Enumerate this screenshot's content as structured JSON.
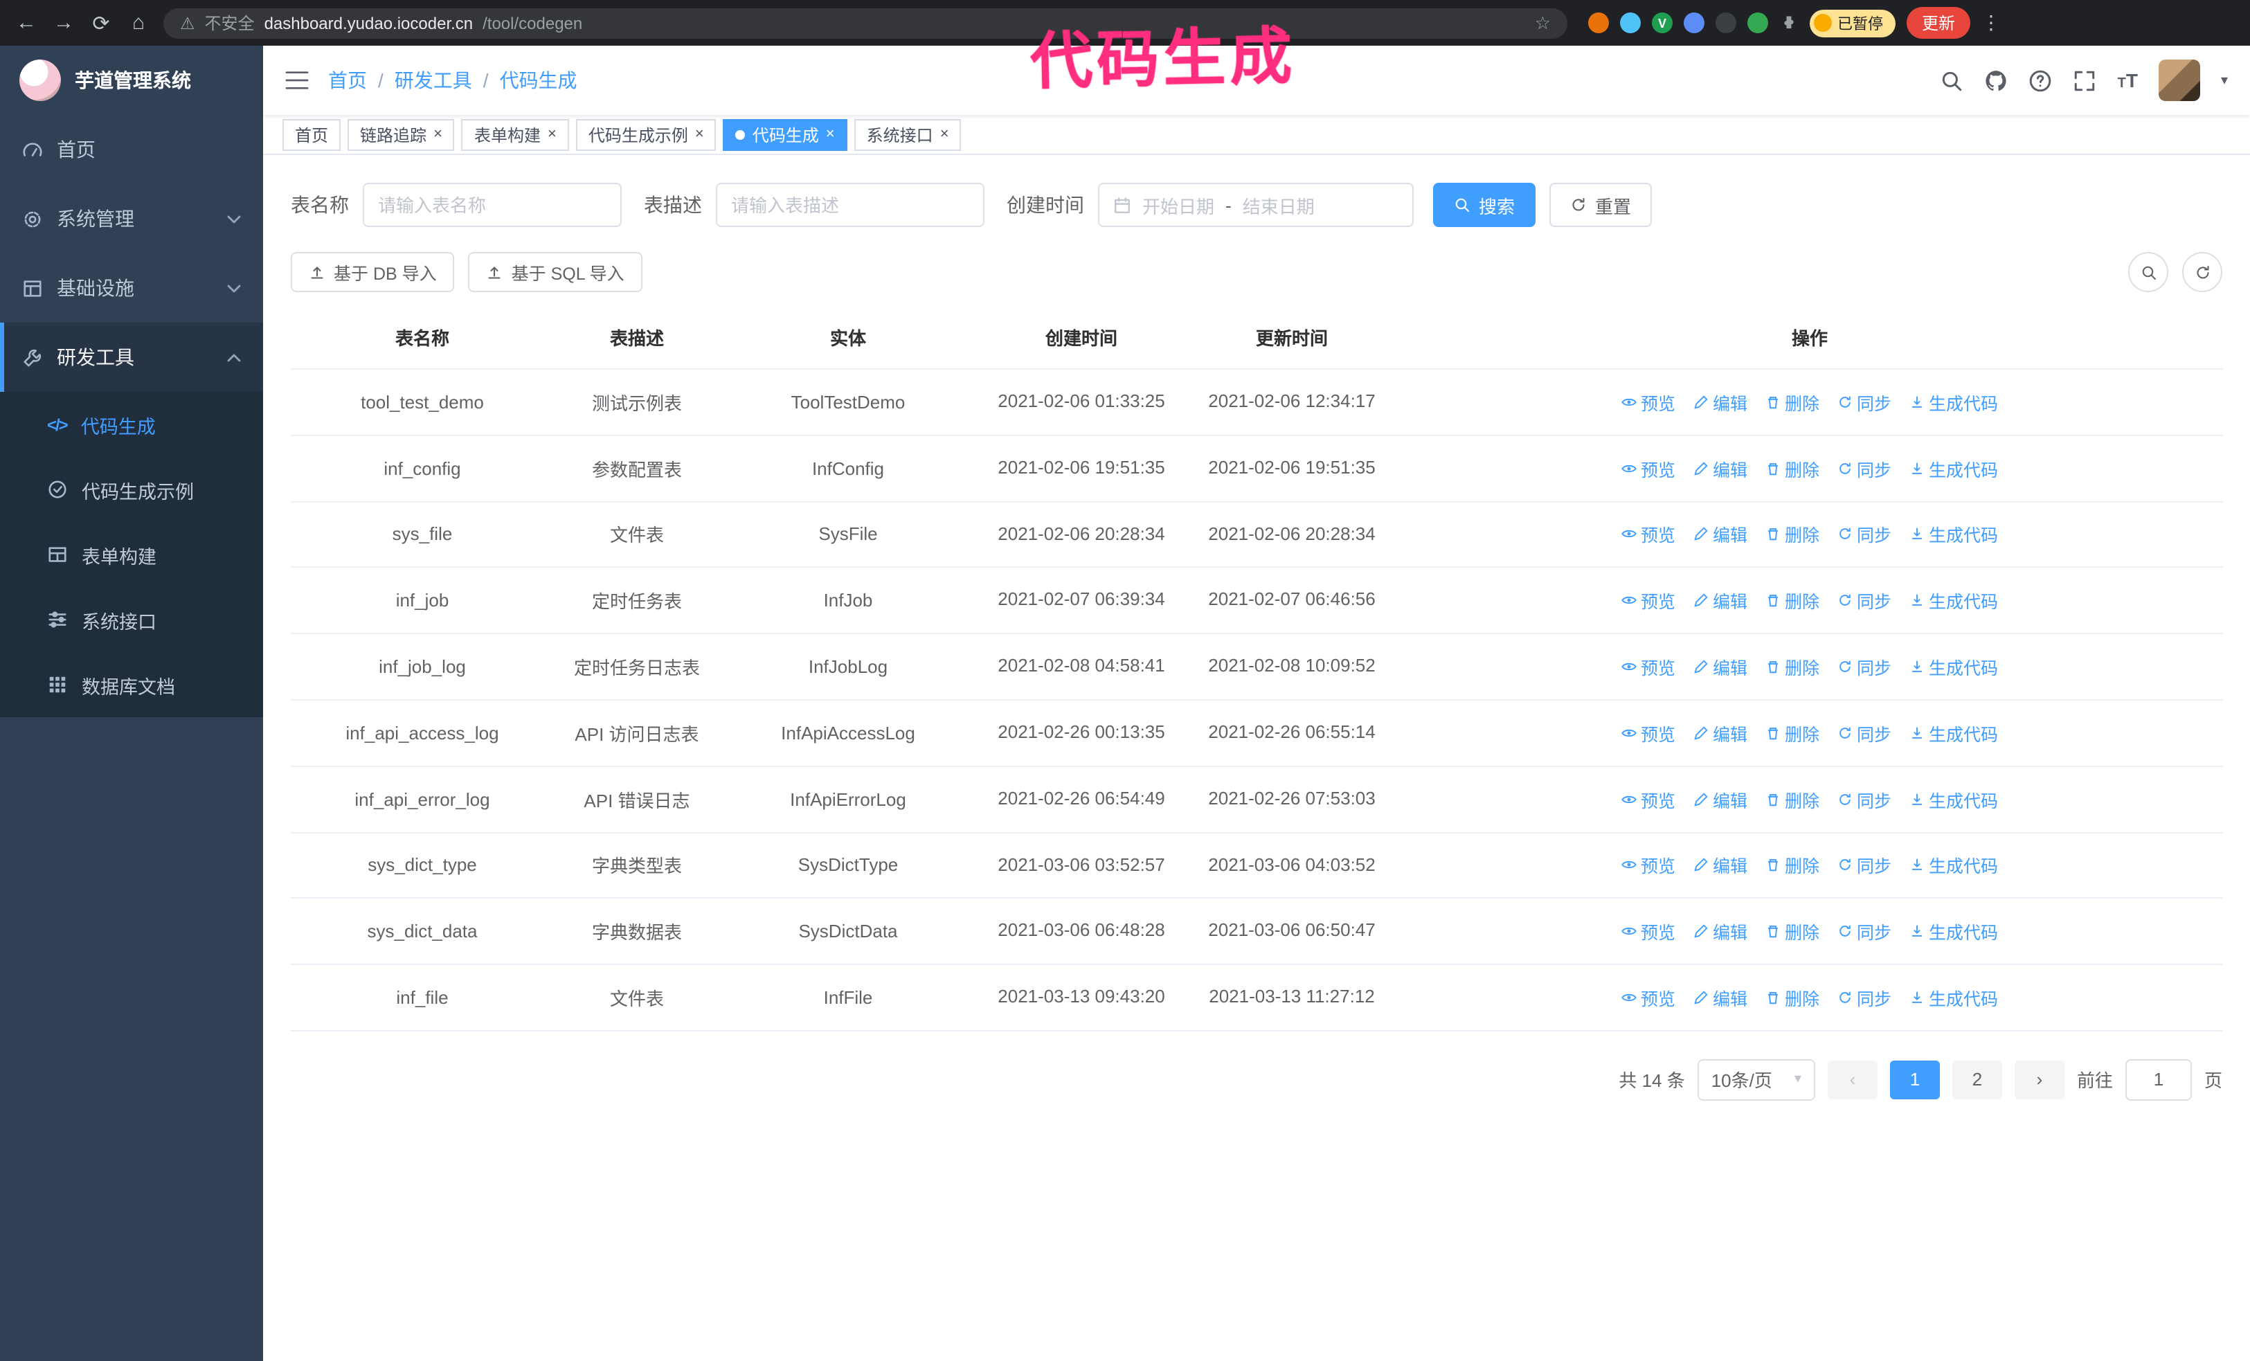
{
  "colors": {
    "primary": "#409eff",
    "sidebar_bg": "#304156",
    "submenu_bg": "#1f2d3d",
    "annotation": "#ff2e7e"
  },
  "glyphs": {
    "back": "←",
    "forward": "→",
    "reload": "⟳",
    "home": "⌂",
    "warning": "⚠",
    "star": "☆",
    "kebab": "⋮",
    "close": "×",
    "separator": "/",
    "caret_down": "▾",
    "prev": "‹",
    "next": "›",
    "code": "</>",
    "t_big": "T",
    "t_small": "T",
    "v_badge": "V"
  },
  "browser": {
    "security_warning": "不安全",
    "url_host": "dashboard.yudao.iocoder.cn",
    "url_path": "/tool/codegen",
    "paused_badge": "已暂停",
    "update_button": "更新"
  },
  "annotation": {
    "text": "代码生成"
  },
  "sidebar": {
    "title": "芋道管理系统",
    "items": [
      {
        "label": "首页"
      },
      {
        "label": "系统管理"
      },
      {
        "label": "基础设施"
      },
      {
        "label": "研发工具"
      }
    ],
    "sub_items": [
      {
        "label": "代码生成"
      },
      {
        "label": "代码生成示例"
      },
      {
        "label": "表单构建"
      },
      {
        "label": "系统接口"
      },
      {
        "label": "数据库文档"
      }
    ]
  },
  "navbar": {
    "breadcrumb": [
      "首页",
      "研发工具",
      "代码生成"
    ]
  },
  "tabs": [
    {
      "label": "首页"
    },
    {
      "label": "链路追踪"
    },
    {
      "label": "表单构建"
    },
    {
      "label": "代码生成示例"
    },
    {
      "label": "代码生成"
    },
    {
      "label": "系统接口"
    }
  ],
  "filters": {
    "table_name_label": "表名称",
    "table_name_placeholder": "请输入表名称",
    "table_desc_label": "表描述",
    "table_desc_placeholder": "请输入表描述",
    "create_time_label": "创建时间",
    "date_start_placeholder": "开始日期",
    "date_separator": "-",
    "date_end_placeholder": "结束日期",
    "search_button": "搜索",
    "reset_button": "重置"
  },
  "toolbar": {
    "import_db": "基于 DB 导入",
    "import_sql": "基于 SQL 导入"
  },
  "table": {
    "headers": [
      "表名称",
      "表描述",
      "实体",
      "创建时间",
      "更新时间",
      "操作"
    ],
    "op_labels": {
      "preview": "预览",
      "edit": "编辑",
      "delete": "删除",
      "sync": "同步",
      "generate": "生成代码"
    },
    "rows": [
      {
        "name": "tool_test_demo",
        "desc": "测试示例表",
        "entity": "ToolTestDemo",
        "created": "2021-02-06 01:33:25",
        "updated": "2021-02-06 12:34:17"
      },
      {
        "name": "inf_config",
        "desc": "参数配置表",
        "entity": "InfConfig",
        "created": "2021-02-06 19:51:35",
        "updated": "2021-02-06 19:51:35"
      },
      {
        "name": "sys_file",
        "desc": "文件表",
        "entity": "SysFile",
        "created": "2021-02-06 20:28:34",
        "updated": "2021-02-06 20:28:34"
      },
      {
        "name": "inf_job",
        "desc": "定时任务表",
        "entity": "InfJob",
        "created": "2021-02-07 06:39:34",
        "updated": "2021-02-07 06:46:56"
      },
      {
        "name": "inf_job_log",
        "desc": "定时任务日志表",
        "entity": "InfJobLog",
        "created": "2021-02-08 04:58:41",
        "updated": "2021-02-08 10:09:52"
      },
      {
        "name": "inf_api_access_log",
        "desc": "API 访问日志表",
        "entity": "InfApiAccessLog",
        "created": "2021-02-26 00:13:35",
        "updated": "2021-02-26 06:55:14"
      },
      {
        "name": "inf_api_error_log",
        "desc": "API 错误日志",
        "entity": "InfApiErrorLog",
        "created": "2021-02-26 06:54:49",
        "updated": "2021-02-26 07:53:03"
      },
      {
        "name": "sys_dict_type",
        "desc": "字典类型表",
        "entity": "SysDictType",
        "created": "2021-03-06 03:52:57",
        "updated": "2021-03-06 04:03:52"
      },
      {
        "name": "sys_dict_data",
        "desc": "字典数据表",
        "entity": "SysDictData",
        "created": "2021-03-06 06:48:28",
        "updated": "2021-03-06 06:50:47"
      },
      {
        "name": "inf_file",
        "desc": "文件表",
        "entity": "InfFile",
        "created": "2021-03-13 09:43:20",
        "updated": "2021-03-13 11:27:12"
      }
    ]
  },
  "pagination": {
    "total": "共 14 条",
    "page_size": "10条/页",
    "pages": [
      "1",
      "2"
    ],
    "goto_label": "前往",
    "goto_value": "1",
    "page_suffix": "页"
  }
}
